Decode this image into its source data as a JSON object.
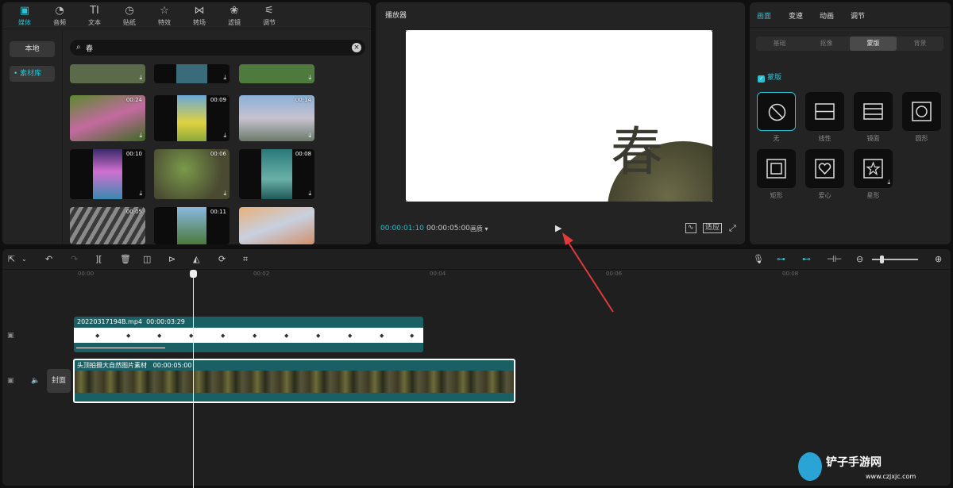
{
  "media_panel": {
    "tabs": [
      {
        "icon": "media-icon",
        "label": "媒体"
      },
      {
        "icon": "audio-icon",
        "label": "音频"
      },
      {
        "icon": "text-icon",
        "label": "文本"
      },
      {
        "icon": "sticker-icon",
        "label": "贴纸"
      },
      {
        "icon": "effects-icon",
        "label": "特效"
      },
      {
        "icon": "transition-icon",
        "label": "转场"
      },
      {
        "icon": "filter-icon",
        "label": "滤镜"
      },
      {
        "icon": "adjust-icon",
        "label": "调节"
      }
    ],
    "sidebar": {
      "local": "本地",
      "library": "素材库"
    },
    "search": {
      "value": "春"
    },
    "thumbs": [
      {
        "duration": "",
        "color": "#5b6b4a"
      },
      {
        "duration": "",
        "color": "#3a6b7a"
      },
      {
        "duration": "",
        "color": "#4e7a3e"
      },
      {
        "duration": "00:24",
        "color": "#4f7a2e"
      },
      {
        "duration": "00:09",
        "color": "#8ba53a"
      },
      {
        "duration": "00:14",
        "color": "#8e9aa8"
      },
      {
        "duration": "00:10",
        "color": "#6a3f8a"
      },
      {
        "duration": "00:06",
        "color": "#5b6640"
      },
      {
        "duration": "00:08",
        "color": "#4a8a8e"
      },
      {
        "duration": "00:05",
        "color": "#6d6d6d"
      },
      {
        "duration": "00:11",
        "color": "#5a7a9a"
      },
      {
        "duration": "",
        "color": "#c98a6a"
      }
    ]
  },
  "player": {
    "title": "播放器",
    "current_time": "00:00:01:10",
    "total_time": "00:00:05:00",
    "quality": "画质 ▾",
    "preview_char": "春",
    "ratio_label": "适应"
  },
  "props": {
    "tabs": [
      "画面",
      "变速",
      "动画",
      "调节"
    ],
    "subtabs": [
      "基础",
      "抠像",
      "蒙版",
      "背景"
    ],
    "mask_label": "蒙版",
    "masks": [
      {
        "icon": "none-mask-icon",
        "label": "无"
      },
      {
        "icon": "linear-mask-icon",
        "label": "线性"
      },
      {
        "icon": "mirror-mask-icon",
        "label": "镜面"
      },
      {
        "icon": "circle-mask-icon",
        "label": "圆形"
      },
      {
        "icon": "rect-mask-icon",
        "label": "矩形"
      },
      {
        "icon": "heart-mask-icon",
        "label": "爱心"
      },
      {
        "icon": "star-mask-icon",
        "label": "星形"
      }
    ]
  },
  "timeline": {
    "ruler": [
      "00:00",
      "00:02",
      "00:04",
      "00:06",
      "00:08"
    ],
    "text_clip": {
      "name": "20220317194B.mp4",
      "duration": "00:00:03:29"
    },
    "main_clip": {
      "name": "头顶拍摄大自然图片素材",
      "duration": "00:00:05:00"
    },
    "cover_label": "封面"
  },
  "watermark": {
    "title": "铲子手游网",
    "url": "www.czjxjc.com"
  },
  "colors": {
    "accent": "#27c3d4",
    "clip": "#1a5f63"
  }
}
